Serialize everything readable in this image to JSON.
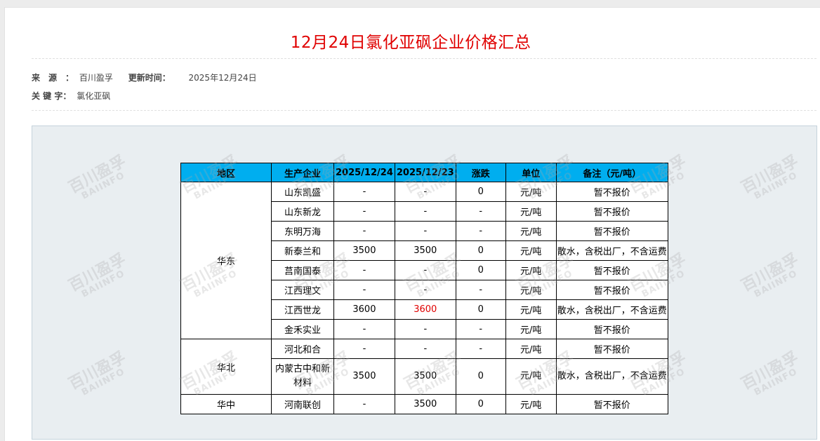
{
  "title": "12月24日氯化亚砜企业价格汇总",
  "meta": {
    "source_label": "来　源　：",
    "source_value": "百川盈孚",
    "update_label": "更新时间：",
    "update_value": "2025年12月24日",
    "keyword_label": "关 键 字：",
    "keyword_value": "氯化亚砜"
  },
  "watermark": {
    "cn": "百川盈孚",
    "en": "BAIINFO"
  },
  "table": {
    "headers": [
      "地区",
      "生产企业",
      "2025/12/24",
      "2025/12/23",
      "涨跌",
      "单位",
      "备注（元/吨）"
    ],
    "groups": [
      {
        "region": "华东",
        "rows": [
          {
            "company": "山东凯盛",
            "d1": "-",
            "d2": "-",
            "change": "0",
            "unit": "元/吨",
            "note": "暂不报价"
          },
          {
            "company": "山东新龙",
            "d1": "-",
            "d2": "-",
            "change": "-",
            "unit": "元/吨",
            "note": "暂不报价"
          },
          {
            "company": "东明万海",
            "d1": "-",
            "d2": "-",
            "change": "-",
            "unit": "元/吨",
            "note": "暂不报价"
          },
          {
            "company": "新泰兰和",
            "d1": "3500",
            "d2": "3500",
            "change": "0",
            "unit": "元/吨",
            "note": "散水，含税出厂，不含运费"
          },
          {
            "company": "莒南国泰",
            "d1": "-",
            "d2": "-",
            "change": "0",
            "unit": "元/吨",
            "note": "暂不报价"
          },
          {
            "company": "江西理文",
            "d1": "-",
            "d2": "-",
            "change": "-",
            "unit": "元/吨",
            "note": "暂不报价"
          },
          {
            "company": "江西世龙",
            "d1": "3600",
            "d2": "3600",
            "change": "0",
            "unit": "元/吨",
            "note": "散水，含税出厂，不含运费",
            "d2_red": true
          },
          {
            "company": "金禾实业",
            "d1": "-",
            "d2": "-",
            "change": "-",
            "unit": "元/吨",
            "note": "暂不报价"
          }
        ]
      },
      {
        "region": "华北",
        "rows": [
          {
            "company": "河北和合",
            "d1": "-",
            "d2": "-",
            "change": "-",
            "unit": "元/吨",
            "note": "暂不报价"
          },
          {
            "company": "内蒙古中和新材料",
            "d1": "3500",
            "d2": "3500",
            "change": "0",
            "unit": "元/吨",
            "note": "散水，含税出厂，不含运费",
            "wrap": true
          }
        ]
      },
      {
        "region": "华中",
        "rows": [
          {
            "company": "河南联创",
            "d1": "-",
            "d2": "3500",
            "change": "0",
            "unit": "元/吨",
            "note": "暂不报价"
          }
        ]
      }
    ]
  }
}
